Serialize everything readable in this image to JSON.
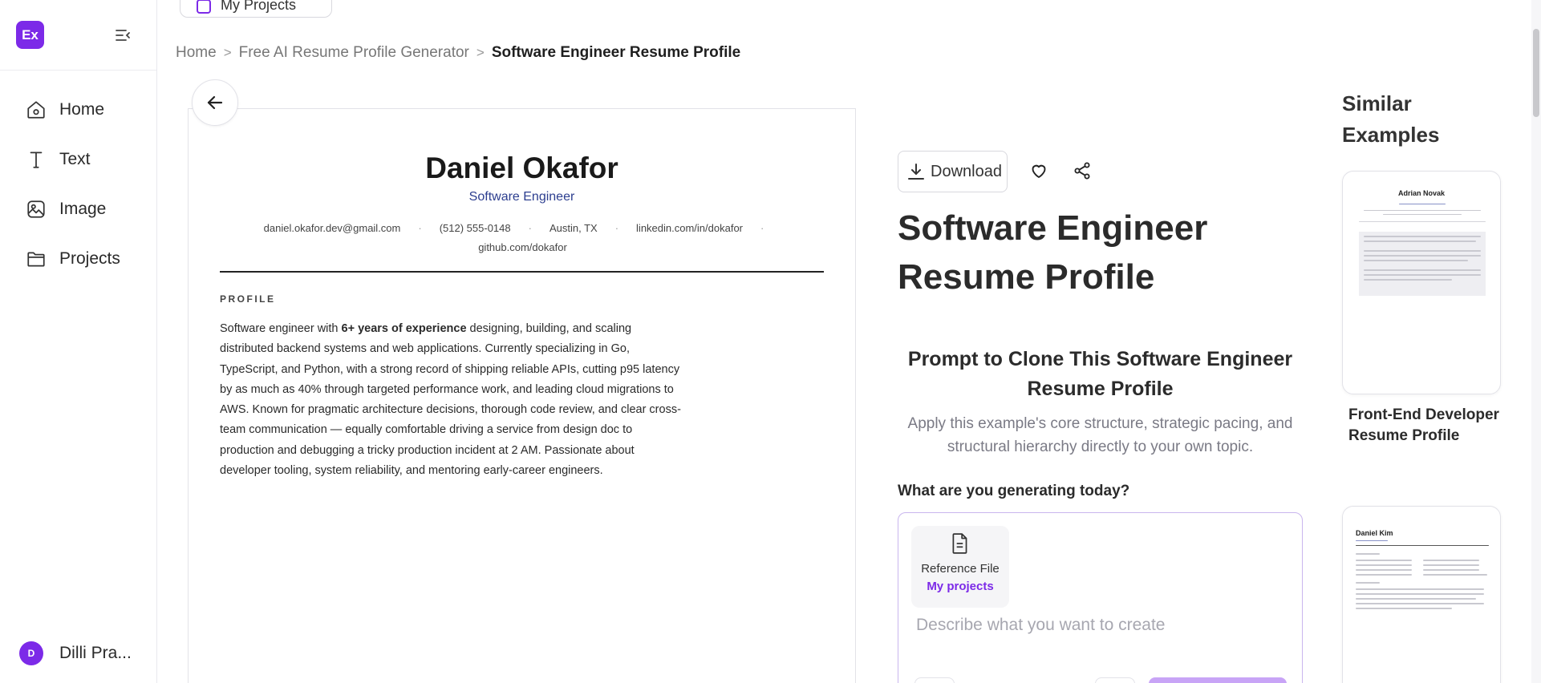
{
  "sidebar": {
    "logo": "Ex",
    "nav": [
      {
        "label": "Home",
        "icon": "home-icon"
      },
      {
        "label": "Text",
        "icon": "text-icon"
      },
      {
        "label": "Image",
        "icon": "image-icon"
      },
      {
        "label": "Projects",
        "icon": "folder-icon"
      }
    ],
    "user": {
      "initial": "D",
      "name": "Dilli Pra..."
    }
  },
  "topbar": {
    "my_projects": "My Projects"
  },
  "breadcrumb": {
    "items": [
      "Home",
      "Free AI Resume Profile Generator"
    ],
    "separator": ">",
    "current": "Software Engineer Resume Profile"
  },
  "resume": {
    "name": "Daniel Okafor",
    "title": "Software Engineer",
    "contacts": [
      "daniel.okafor.dev@gmail.com",
      "(512) 555-0148",
      "Austin, TX",
      "linkedin.com/in/dokafor",
      "github.com/dokafor"
    ],
    "contact_separator": "·",
    "section_label": "PROFILE",
    "profile_prefix": "Software engineer with ",
    "profile_bold": "6+ years of experience",
    "profile_rest": " designing, building, and scaling distributed backend systems and web applications. Currently specializing in Go, TypeScript, and Python, with a strong record of shipping reliable APIs, cutting p95 latency by as much as 40% through targeted performance work, and leading cloud migrations to AWS. Known for pragmatic architecture decisions, thorough code review, and clear cross-team communication — equally comfortable driving a service from design doc to production and debugging a tricky production incident at 2 AM. Passionate about developer tooling, system reliability, and mentoring early-career engineers."
  },
  "detail": {
    "download_label": "Download",
    "heading": "Software Engineer Resume Profile",
    "prompt_heading": "Prompt to Clone This Software Engineer Resume Profile",
    "prompt_sub": "Apply this example's core structure, strategic pacing, and structural hierarchy directly to your own topic.",
    "generate_label": "What are you generating today?",
    "reference_label": "Reference File",
    "reference_link": "My projects",
    "input_placeholder": "Describe what you want to create"
  },
  "similar": {
    "heading": "Similar Examples",
    "items": [
      {
        "caption": "Front-End Developer Resume Profile",
        "thumb_name": "Adrian Novak"
      },
      {
        "caption": "",
        "thumb_name": "Daniel Kim"
      }
    ]
  },
  "colors": {
    "accent": "#7c2ae8",
    "resume_title": "#2c3e8f"
  }
}
